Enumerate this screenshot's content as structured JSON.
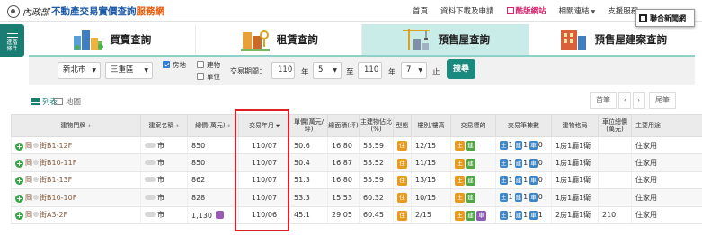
{
  "header": {
    "ministry": "內政部",
    "site_name": "不動產交易實價查詢",
    "site_name_suffix": "服務網",
    "nav": [
      {
        "label": "首頁"
      },
      {
        "label": "資料下載及申請"
      },
      {
        "label": "酷版網站"
      },
      {
        "label": "相關連結"
      },
      {
        "label": "支援服務"
      }
    ],
    "overlay_badge": "聯合新聞網"
  },
  "side_tab": {
    "line1": "進階",
    "line2": "條件"
  },
  "tabs": [
    {
      "label": "買賣查詢",
      "active": false,
      "icon": "buildings-icon"
    },
    {
      "label": "租賃查詢",
      "active": false,
      "icon": "key-building-icon"
    },
    {
      "label": "預售屋查詢",
      "active": true,
      "icon": "crane-icon"
    },
    {
      "label": "預售屋建案查詢",
      "active": false,
      "icon": "apartment-block-icon"
    }
  ],
  "filter": {
    "city": "新北市",
    "district": "三重區",
    "opt_address": "房地",
    "opt_building": "建物",
    "opt_unit": "單位",
    "opt_address_checked": true,
    "opt_building_checked": false,
    "opt_unit_checked": false,
    "period_label": "交易期間：",
    "year_from": "110",
    "year_unit": "年",
    "month_from": "5",
    "to_label": "至",
    "year_to": "110",
    "year_unit2": "年",
    "month_to": "7",
    "end_label": "止",
    "search_label": "搜尋"
  },
  "view": {
    "list_label": "列表",
    "map_label": "地圖",
    "first_label": "首筆",
    "prev_label": "‹",
    "next_label": "›",
    "last_label": "尾筆"
  },
  "table": {
    "headers": [
      "建物門牌",
      "建案名稱",
      "總價(萬元)",
      "交易年月",
      "單價(萬元/坪)",
      "總面積(坪)",
      "主建物佔比(%)",
      "型態",
      "樓別/樓高",
      "交易標的",
      "交易筆棟數",
      "建物格局",
      "車位總價(萬元)",
      "主要用途"
    ],
    "rows": [
      {
        "addr_pre": "岡",
        "addr_post": "街B1-12F",
        "project_suffix": "市",
        "price": "850",
        "date": "110/07",
        "unit_price": "50.6",
        "area": "16.80",
        "ratio": "55.59",
        "type": "住",
        "floor": "12/15",
        "land": "1",
        "bld": "1",
        "park": "0",
        "layout": "1房1廳1衛",
        "parking": "",
        "use": "住家用"
      },
      {
        "addr_pre": "岡",
        "addr_post": "街B10-11F",
        "project_suffix": "市",
        "price": "850",
        "date": "110/07",
        "unit_price": "50.4",
        "area": "16.87",
        "ratio": "55.52",
        "type": "住",
        "floor": "11/15",
        "land": "1",
        "bld": "1",
        "park": "0",
        "layout": "1房1廳1衛",
        "parking": "",
        "use": "住家用"
      },
      {
        "addr_pre": "岡",
        "addr_post": "街B1-13F",
        "project_suffix": "市",
        "price": "862",
        "date": "110/07",
        "unit_price": "51.3",
        "area": "16.80",
        "ratio": "55.59",
        "type": "住",
        "floor": "13/15",
        "land": "1",
        "bld": "1",
        "park": "0",
        "layout": "1房1廳1衛",
        "parking": "",
        "use": "住家用"
      },
      {
        "addr_pre": "岡",
        "addr_post": "街B10-10F",
        "project_suffix": "市",
        "price": "828",
        "date": "110/07",
        "unit_price": "53.3",
        "area": "15.53",
        "ratio": "60.32",
        "type": "住",
        "floor": "10/15",
        "land": "1",
        "bld": "1",
        "park": "0",
        "layout": "1房1廳1衛",
        "parking": "",
        "use": "住家用"
      },
      {
        "addr_pre": "岡",
        "addr_post": "街A3-2F",
        "project_suffix": "市",
        "price": "1,130",
        "date": "110/06",
        "unit_price": "45.1",
        "area": "29.05",
        "ratio": "60.45",
        "type": "住",
        "floor": "2/15",
        "land": "1",
        "bld": "1",
        "park": "1",
        "layout": "2房1廳1衛",
        "parking": "210",
        "use": "住家用"
      }
    ]
  },
  "colors": {
    "brand_blue": "#1e5aa8",
    "brand_orange": "#e8590c",
    "teal": "#1a7d73",
    "highlight_red": "#e01e24"
  }
}
